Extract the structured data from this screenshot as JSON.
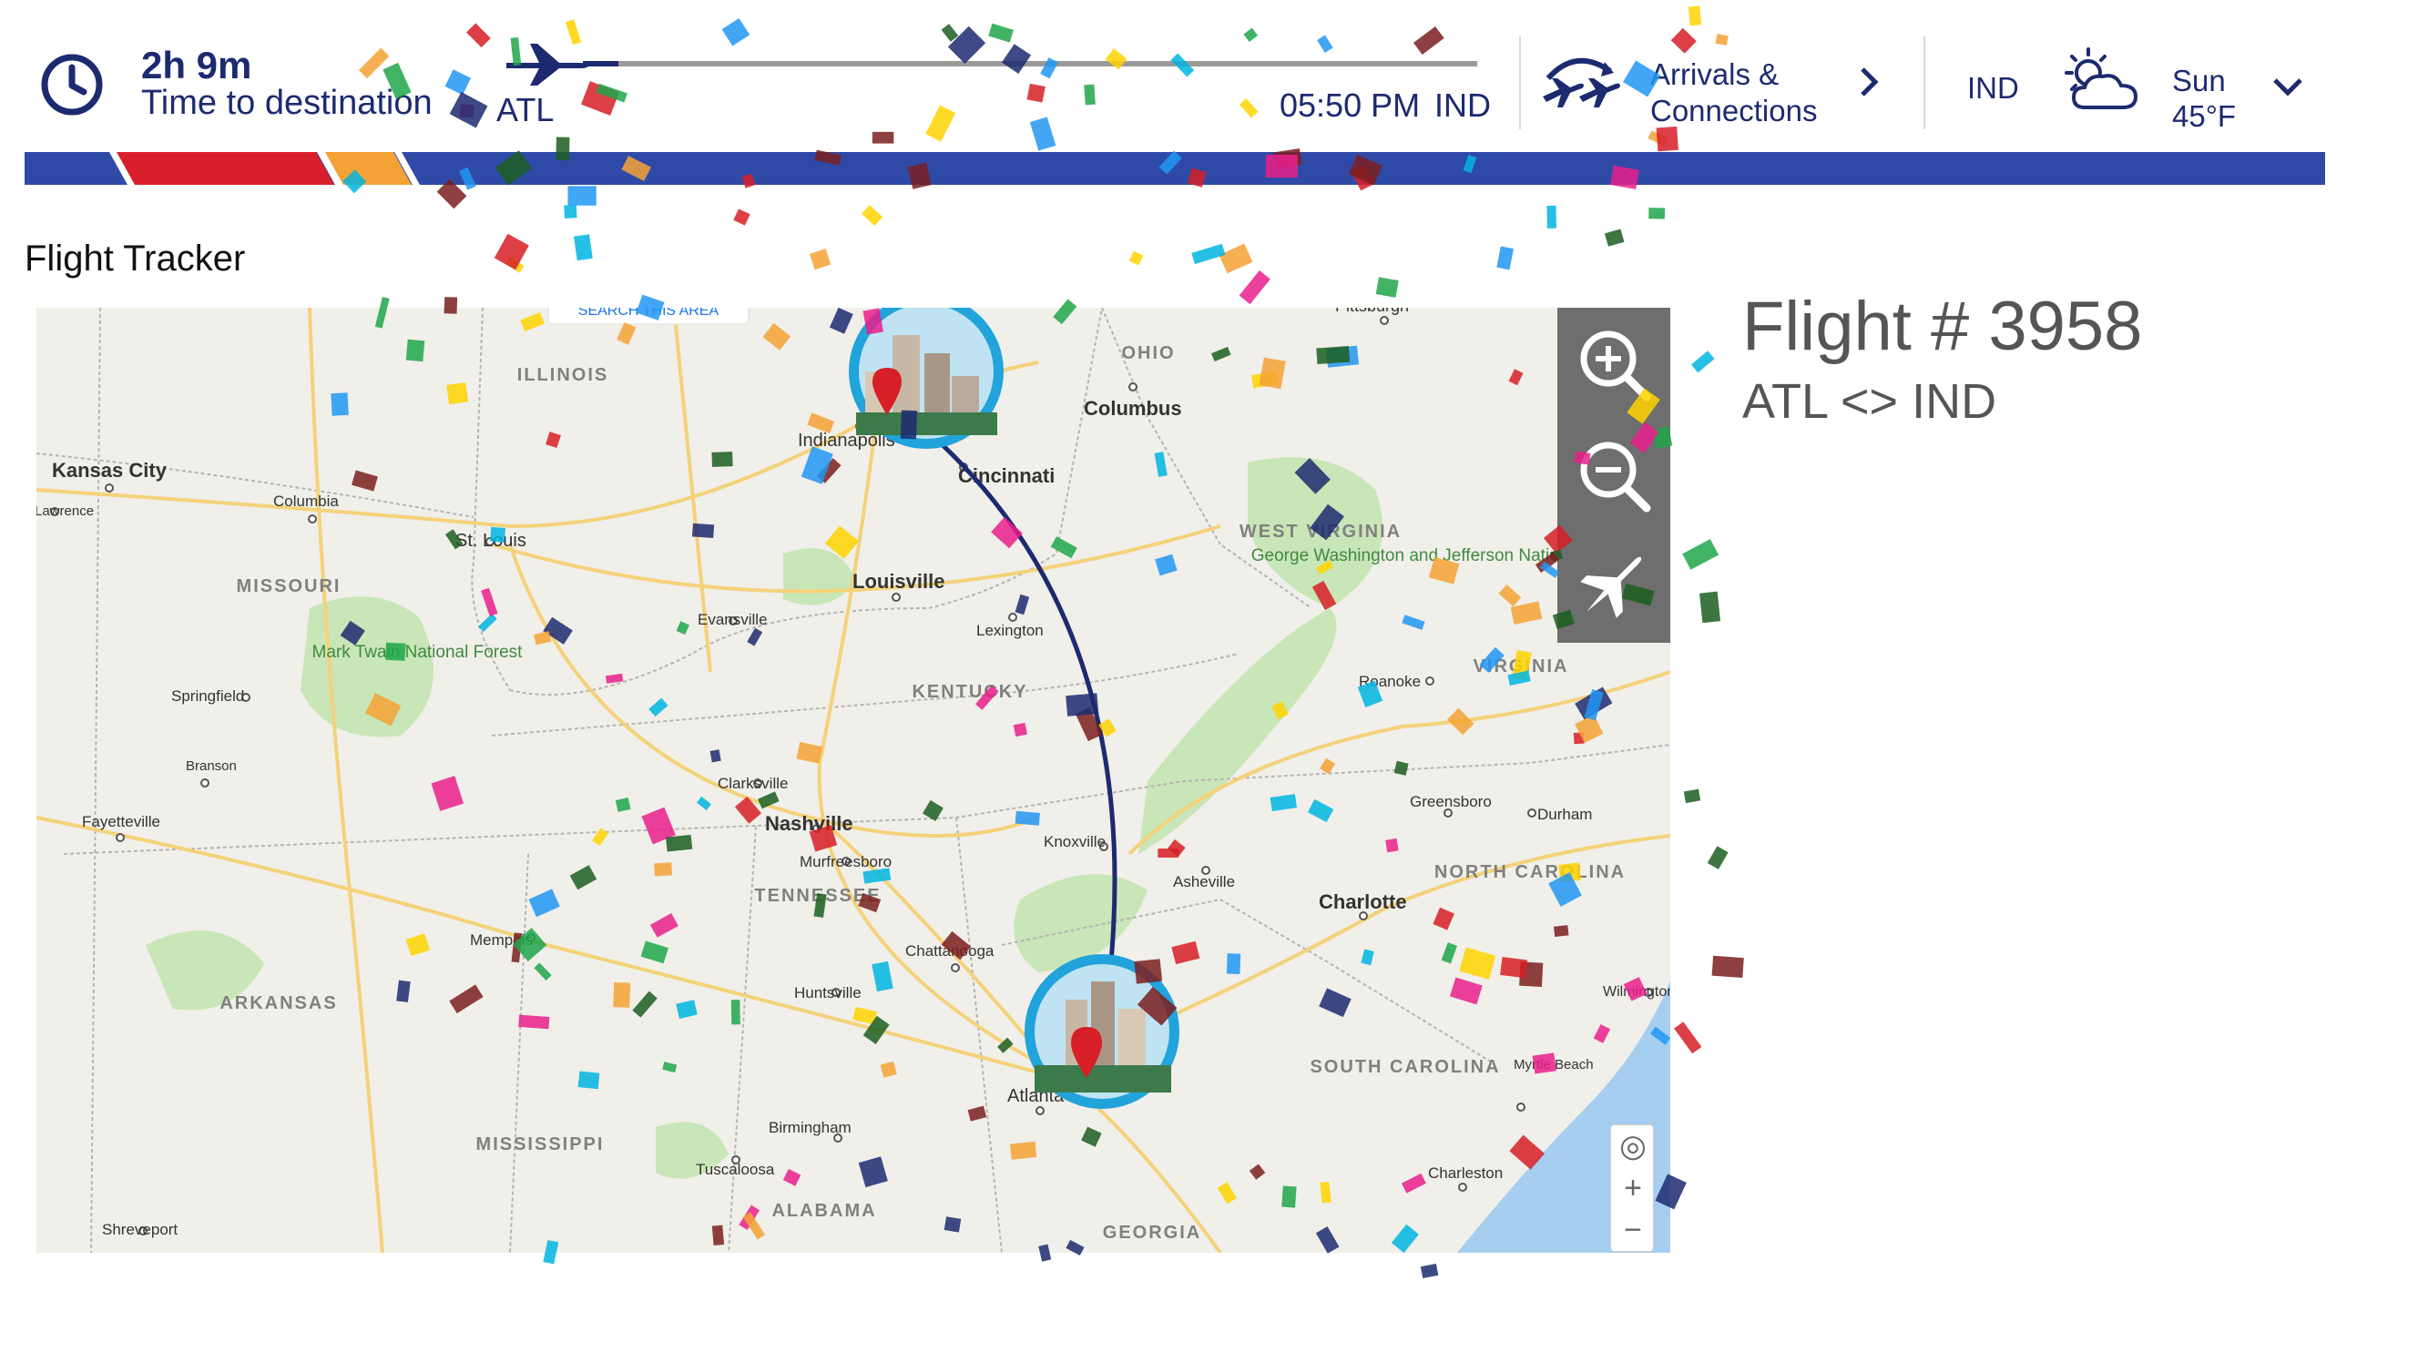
{
  "header": {
    "time_remaining": "2h 9m",
    "time_label": "Time to destination",
    "origin": "ATL",
    "arrival_time": "05:50 PM",
    "destination": "IND",
    "progress_fraction": 0.04,
    "arrivals_label": "Arrivals & Connections",
    "weather": {
      "airport": "IND",
      "day": "Sun",
      "temp": "45°F",
      "icon": "partly-cloudy-icon"
    }
  },
  "colors": {
    "navy": "#1c2a70",
    "stripe_blue": "#2f4aa6",
    "stripe_red": "#d91f2b",
    "stripe_orange": "#f4a235",
    "pin_red": "#d61f26",
    "city_ring": "#21a3dc"
  },
  "page": {
    "section_title": "Flight Tracker"
  },
  "flight": {
    "number": "Flight # 3958",
    "route": "ATL <> IND"
  },
  "map": {
    "search_area_label": "SEARCH THIS AREA",
    "states": [
      "ILLINOIS",
      "OHIO",
      "MISSOURI",
      "KENTUCKY",
      "WEST VIRGINIA",
      "VIRGINIA",
      "TENNESSEE",
      "NORTH CAROLINA",
      "ARKANSAS",
      "SOUTH CAROLINA",
      "MISSISSIPPI",
      "ALABAMA",
      "GEORGIA"
    ],
    "cities": [
      "Kansas City",
      "Columbia",
      "St. Louis",
      "Springfield",
      "Indianapolis",
      "Columbus",
      "Cincinnati",
      "Louisville",
      "Lexington",
      "Evansville",
      "Nashville",
      "Murfreesboro",
      "Clarksville",
      "Knoxville",
      "Asheville",
      "Charlotte",
      "Greensboro",
      "Durham",
      "Roanoke",
      "Chattanooga",
      "Huntsville",
      "Birmingham",
      "Atlanta",
      "Memphis",
      "Tuscaloosa",
      "Shreveport",
      "Fayetteville",
      "Branson",
      "Charleston",
      "Myrtle Beach",
      "Wilmington",
      "Pittsburgh",
      "Lawrence"
    ],
    "features": [
      "Mark Twain National Forest",
      "George Washington and Jefferson National Forest"
    ],
    "controls": {
      "zoom_in": "zoom-in-icon",
      "zoom_out": "zoom-out-icon",
      "recenter": "plane-icon",
      "plus": "+",
      "minus": "−"
    }
  }
}
